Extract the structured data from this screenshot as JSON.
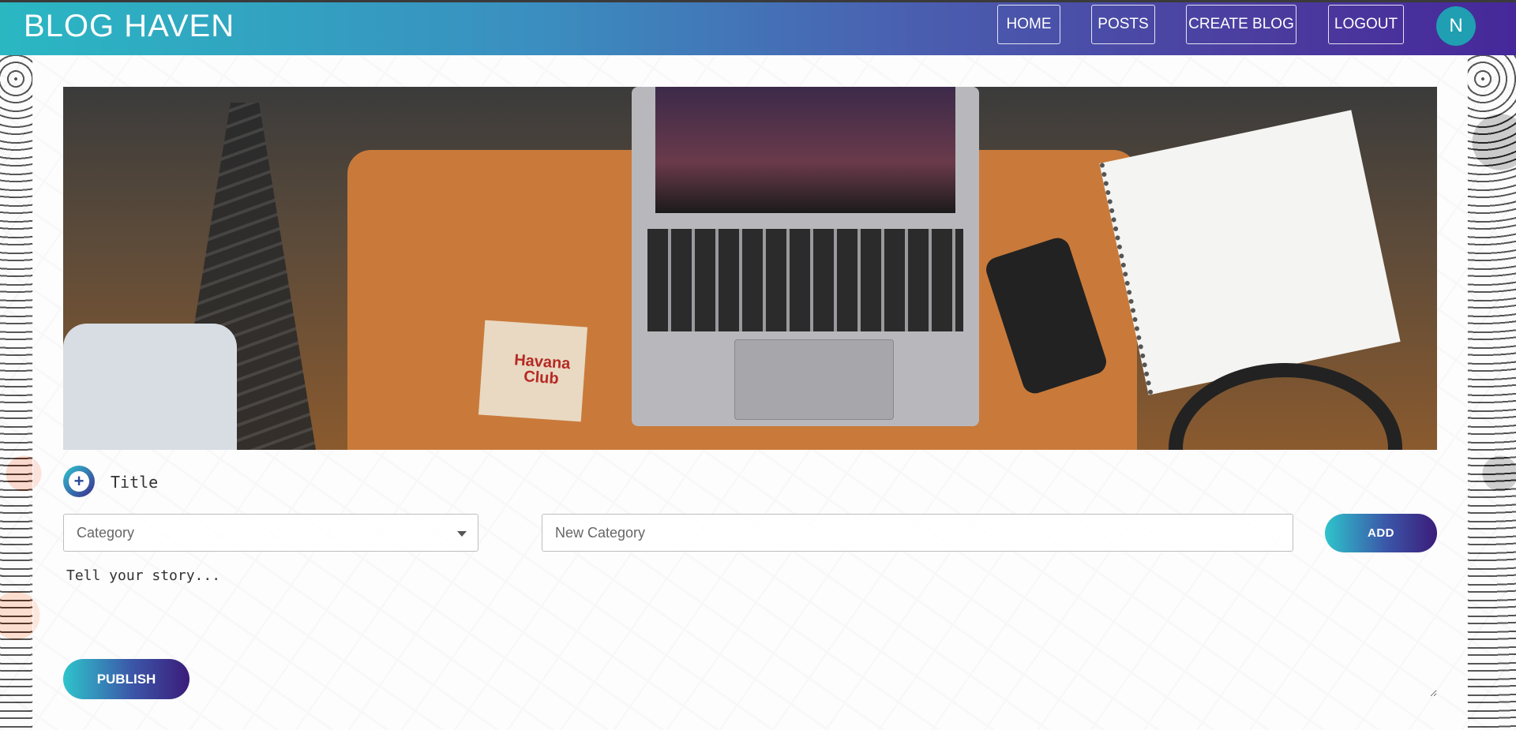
{
  "app": {
    "brand": "BLOG HAVEN"
  },
  "nav": {
    "home": "HOME",
    "posts": "POSTS",
    "create_blog": "CREATE BLOG",
    "logout": "LOGOUT",
    "avatar_initial": "N"
  },
  "banner": {
    "coaster_text": "Havana Club"
  },
  "form": {
    "title_placeholder": "Title",
    "category_selected": "Category",
    "new_category_placeholder": "New Category",
    "add_label": "ADD",
    "story_placeholder": "Tell your story...",
    "publish_label": "PUBLISH"
  },
  "colors": {
    "gradient_start": "#2ec4cc",
    "gradient_end": "#3b1c7a",
    "avatar": "#1f9fb1"
  }
}
